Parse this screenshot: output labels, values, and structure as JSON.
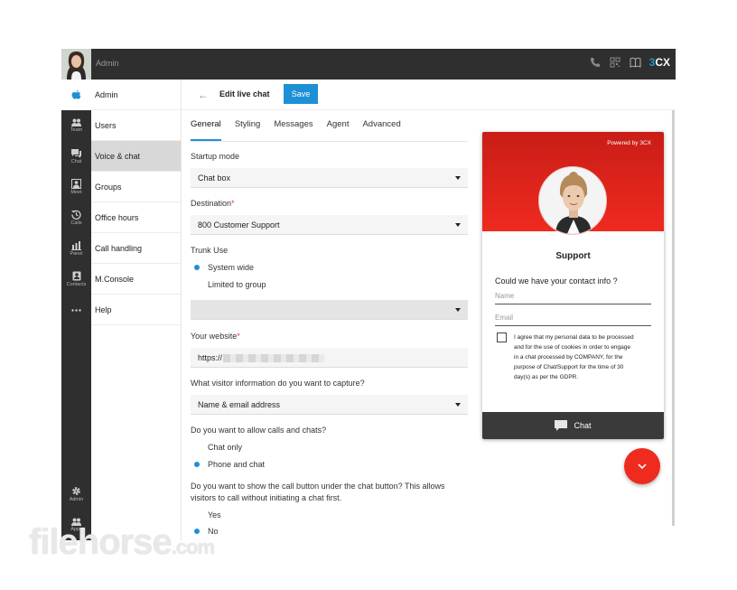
{
  "topbar": {
    "user_label": "Admin",
    "brand_prefix": "3",
    "brand_suffix": "CX",
    "icons": [
      "phone-icon",
      "qr-code-icon",
      "book-icon"
    ]
  },
  "rail": {
    "items": [
      {
        "label": "Team",
        "icon": "team-icon"
      },
      {
        "label": "Chat",
        "icon": "chat-icon"
      },
      {
        "label": "Meet",
        "icon": "meet-icon"
      },
      {
        "label": "Calls",
        "icon": "history-icon"
      },
      {
        "label": "Panel",
        "icon": "panel-icon"
      },
      {
        "label": "Contacts",
        "icon": "contacts-icon"
      },
      {
        "label": "",
        "icon": "more-icon"
      },
      {
        "label": "Admin",
        "icon": "gear-icon"
      },
      {
        "label": "Apps",
        "icon": "apps-icon"
      }
    ]
  },
  "subnav": {
    "items": [
      {
        "label": "Admin"
      },
      {
        "label": "Users"
      },
      {
        "label": "Voice & chat"
      },
      {
        "label": "Groups"
      },
      {
        "label": "Office hours"
      },
      {
        "label": "Call handling"
      },
      {
        "label": "M.Console"
      },
      {
        "label": "Help"
      }
    ],
    "active": "Voice & chat"
  },
  "header": {
    "title": "Edit live chat",
    "save_label": "Save"
  },
  "tabs": [
    {
      "label": "General"
    },
    {
      "label": "Styling"
    },
    {
      "label": "Messages"
    },
    {
      "label": "Agent"
    },
    {
      "label": "Advanced"
    }
  ],
  "form": {
    "startup_mode": {
      "label": "Startup mode",
      "value": "Chat box"
    },
    "destination": {
      "label": "Destination",
      "required": "*",
      "value": "800 Customer Support"
    },
    "trunk_use": {
      "label": "Trunk Use",
      "options": [
        {
          "label": "System wide",
          "selected": true
        },
        {
          "label": "Limited to group",
          "selected": false
        }
      ],
      "group_value": ""
    },
    "website": {
      "label": "Your website",
      "required": "*",
      "value": "https://"
    },
    "visitor_info": {
      "label": "What visitor information do you want to capture?",
      "value": "Name & email address"
    },
    "calls_chats": {
      "label": "Do you want to allow calls and chats?",
      "options": [
        {
          "label": "Chat only",
          "selected": false
        },
        {
          "label": "Phone and chat",
          "selected": true
        }
      ]
    },
    "call_button": {
      "label_line1": "Do you want to show the call button under the chat button? This allows",
      "label_line2": "visitors to call without initiating a chat first.",
      "options": [
        {
          "label": "Yes",
          "selected": false
        },
        {
          "label": "No",
          "selected": true
        }
      ]
    }
  },
  "chat_preview": {
    "powered_by": "Powered by 3CX",
    "agent_name": "Support",
    "question": "Could we have your contact info ?",
    "name_placeholder": "Name",
    "email_placeholder": "Email",
    "consent_lines": [
      "I agree that my personal data to be processed",
      "and for the use of cookies in order to engage",
      "in a chat processed by COMPANY, for the",
      "purpose of Chat/Support for the time of  30",
      "day(s) as per the GDPR."
    ],
    "footer_label": "Chat",
    "accent_color": "#ef2a1f"
  },
  "watermark": {
    "text": "filehorse",
    "suffix": ".com"
  },
  "colors": {
    "primary": "#1e90d6",
    "dark": "#2f2f2f",
    "chat_red": "#ef2a1f"
  }
}
